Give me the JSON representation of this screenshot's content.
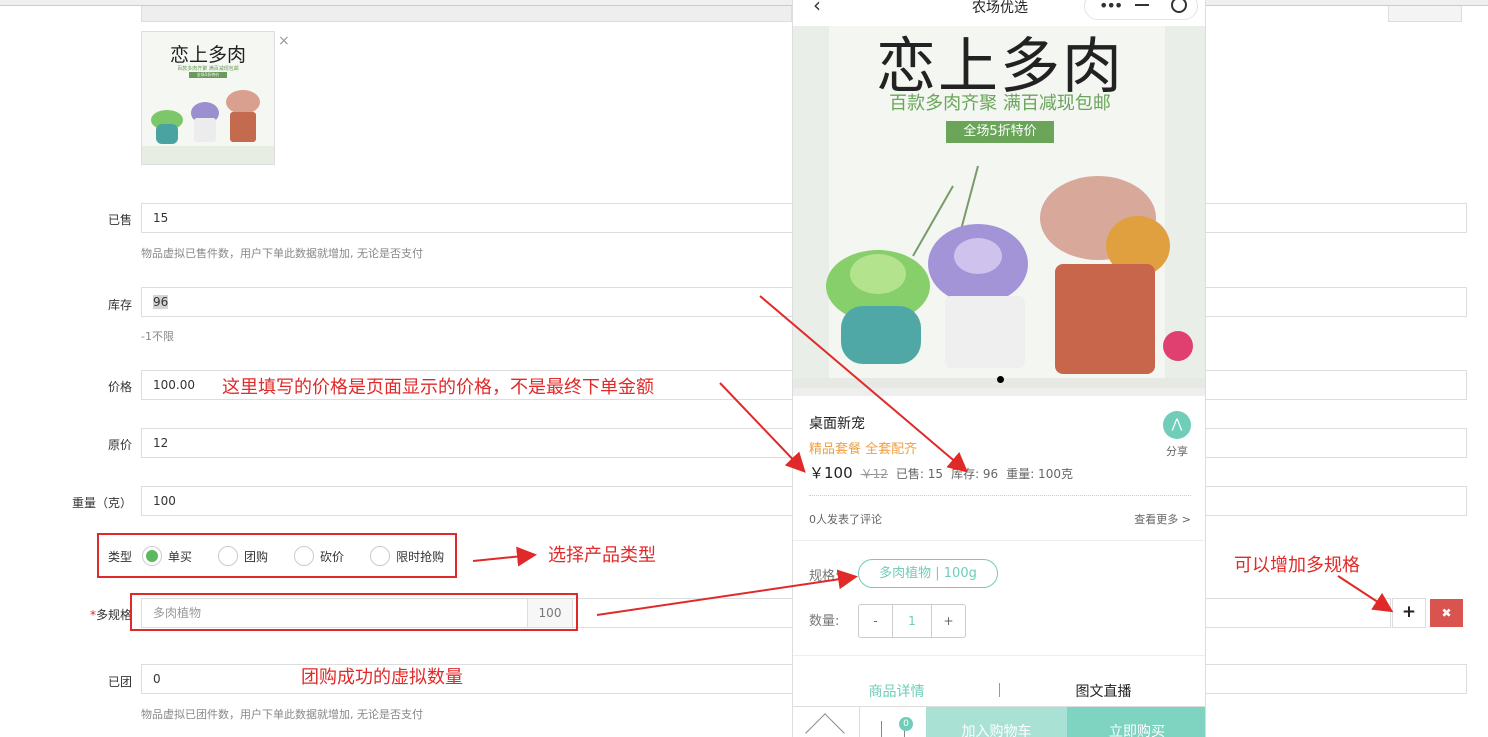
{
  "form": {
    "sold_label": "已售",
    "sold_value": "15",
    "sold_hint": "物品虚拟已售件数，用户下单此数据就增加, 无论是否支付",
    "stock_label": "库存",
    "stock_value": "96",
    "stock_hint": "-1不限",
    "price_label": "价格",
    "price_value": "100.00",
    "orig_price_label": "原价",
    "orig_price_value": "12",
    "weight_label": "重量（克）",
    "weight_value": "100",
    "type_label": "类型",
    "types": [
      "单买",
      "团购",
      "砍价",
      "限时抢购"
    ],
    "multi_spec_label": "多规格",
    "spec_name_placeholder": "多肉植物",
    "spec_value": "100",
    "grouped_label": "已团",
    "grouped_value": "0",
    "grouped_hint": "物品虚拟已团件数，用户下单此数据就增加, 无论是否支付"
  },
  "annotations": {
    "price_note": "这里填写的价格是页面显示的价格，不是最终下单金额",
    "type_note": "选择产品类型",
    "spec_note": "可以增加多规格",
    "group_note": "团购成功的虚拟数量"
  },
  "thumb": {
    "title": "恋上多肉",
    "sub": "百款多肉齐聚 满百减现包邮",
    "tag": "全场5折特价"
  },
  "phone": {
    "title": "农场优选",
    "banner_title": "恋上多肉",
    "banner_sub": "百款多肉齐聚 满百减现包邮",
    "banner_tag": "全场5折特价",
    "product_name": "桌面新宠",
    "product_tag": "精品套餐 全套配齐",
    "share_label": "分享",
    "price": "￥100",
    "orig_price": "￥12",
    "sold_text": "已售: 15",
    "stock_text": "库存: 96",
    "weight_text": "重量: 100克",
    "comments": "0人发表了评论",
    "see_more": "查看更多 >",
    "spec_label": "规格:",
    "spec_value": "多肉植物 | 100g",
    "qty_label": "数量:",
    "qty_minus": "-",
    "qty_value": "1",
    "qty_plus": "+",
    "tab_detail": "商品详情",
    "tab_live": "图文直播",
    "cart_badge": "0",
    "add_cart": "加入购物车",
    "buy_now": "立即购买"
  },
  "colors": {
    "accent": "#70cdb9",
    "annotation": "#e02a2a",
    "tag_orange": "#f0a040",
    "danger": "#d9534f"
  }
}
